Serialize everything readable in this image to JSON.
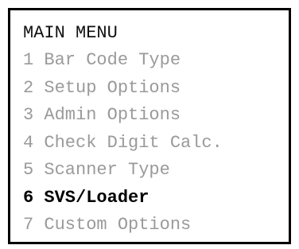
{
  "menu": {
    "title": "MAIN MENU",
    "selected_index": 5,
    "items": [
      {
        "label": "1 Bar Code Type"
      },
      {
        "label": "2 Setup Options"
      },
      {
        "label": "3 Admin Options"
      },
      {
        "label": "4 Check Digit Calc."
      },
      {
        "label": "5 Scanner Type"
      },
      {
        "label": "6 SVS/Loader"
      },
      {
        "label": "7 Custom Options"
      }
    ]
  },
  "colors": {
    "border": "#000000",
    "title_text": "#111111",
    "inactive_text": "#9a9a9a",
    "selected_text": "#000000"
  }
}
